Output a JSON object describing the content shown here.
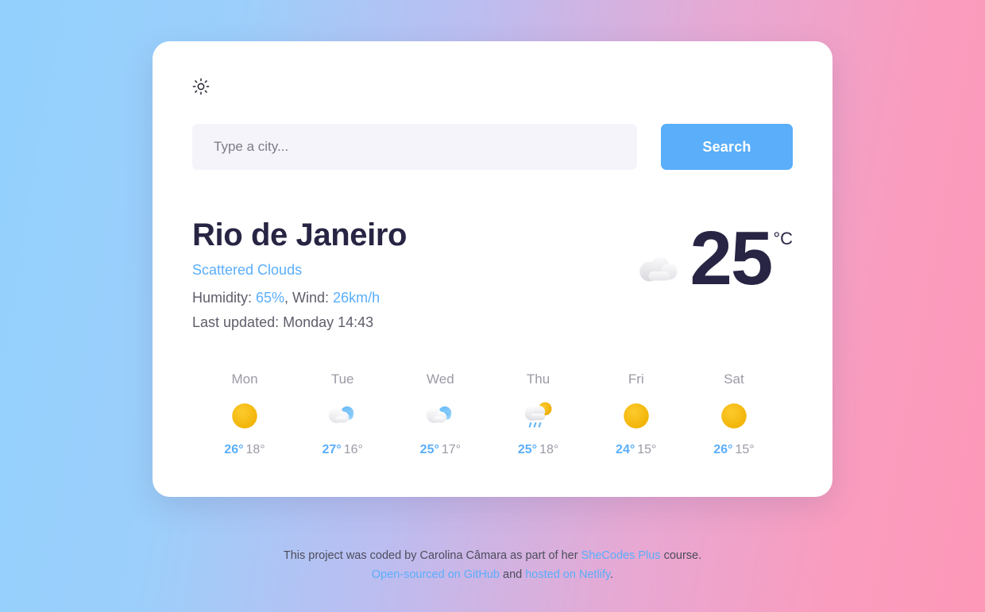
{
  "theme": {
    "accent": "#5aaefa",
    "text_dark": "#272543",
    "text_muted": "#9a9aa6",
    "bg_gradient_from": "#93d0fd",
    "bg_gradient_to": "#fd98b8",
    "card_bg": "#ffffff",
    "input_bg": "#f5f4fa"
  },
  "header": {
    "brightness_icon": "sun-icon"
  },
  "search": {
    "placeholder": "Type a city...",
    "value": "",
    "button_label": "Search"
  },
  "current": {
    "city": "Rio de Janeiro",
    "condition": "Scattered Clouds",
    "humidity_label": "Humidity: ",
    "humidity_value": "65%",
    "wind_label": ", Wind: ",
    "wind_value": "26km/h",
    "last_updated": "Last updated: Monday 14:43",
    "icon": "cloud-icon",
    "temperature": "25",
    "unit": "°C"
  },
  "forecast": {
    "days": [
      {
        "day": "Mon",
        "icon": "sun-icon",
        "max": "26°",
        "min": "18°"
      },
      {
        "day": "Tue",
        "icon": "cloud-icon",
        "max": "27°",
        "min": "16°"
      },
      {
        "day": "Wed",
        "icon": "cloud-icon",
        "max": "25°",
        "min": "17°"
      },
      {
        "day": "Thu",
        "icon": "sun-rain-cloud-icon",
        "max": "25°",
        "min": "18°"
      },
      {
        "day": "Fri",
        "icon": "sun-icon",
        "max": "24°",
        "min": "15°"
      },
      {
        "day": "Sat",
        "icon": "sun-icon",
        "max": "26°",
        "min": "15°"
      }
    ]
  },
  "footer": {
    "line1_part1": "This project was coded by Carolina Câmara as part of her ",
    "line1_link": "SheCodes Plus",
    "line1_part2": " course.",
    "line2_link1": "Open-sourced on GitHub",
    "line2_mid": " and ",
    "line2_link2": "hosted on Netlify",
    "line2_end": "."
  }
}
